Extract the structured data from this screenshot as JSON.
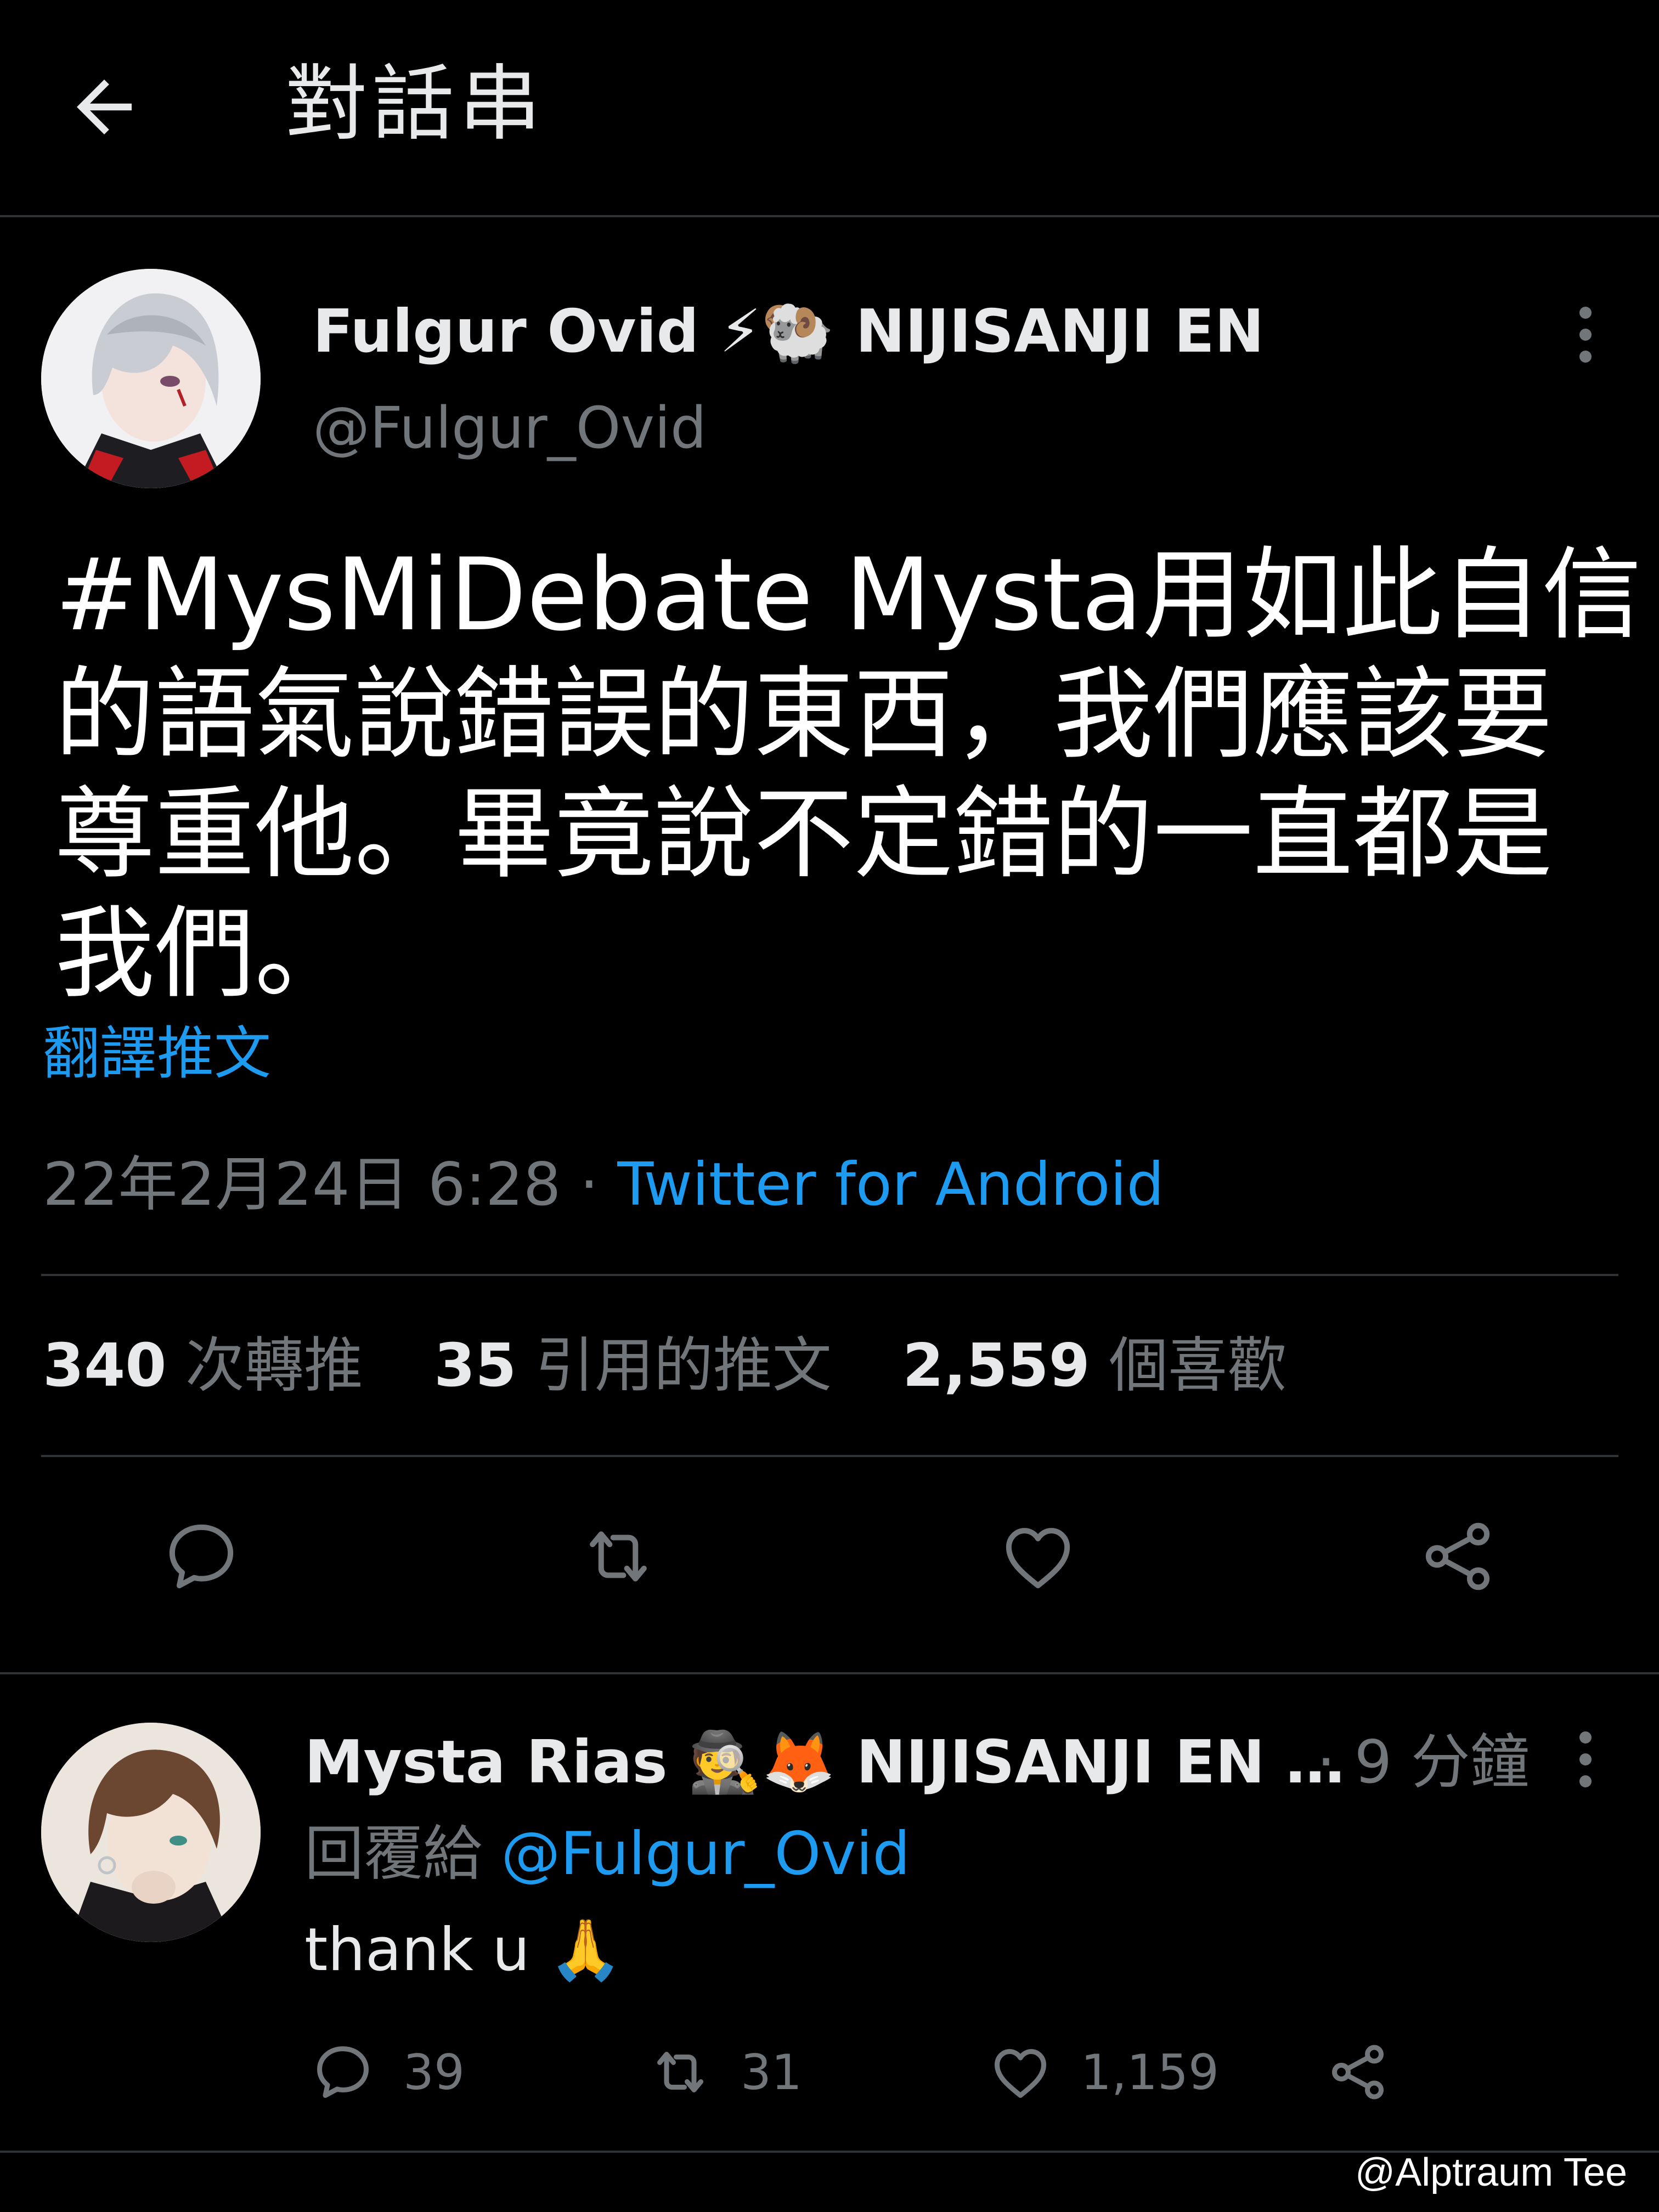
{
  "header": {
    "title": "對話串"
  },
  "main_tweet": {
    "display_name": "Fulgur Ovid ⚡🐏 NIJISANJI EN",
    "handle": "@Fulgur_Ovid",
    "text_lines": [
      "#MysMiDebate Mysta用如此自信",
      "的語氣說錯誤的東西，我們應該要",
      "尊重他。畢竟說不定錯的一直都是",
      "我們。"
    ],
    "translate_label": "翻譯推文",
    "timestamp": "22年2月24日 6:28",
    "separator": " · ",
    "source": "Twitter for Android",
    "stats": {
      "retweets_count": "340",
      "retweets_label": "次轉推",
      "quotes_count": "35",
      "quotes_label": "引用的推文",
      "likes_count": "2,559",
      "likes_label": "個喜歡"
    }
  },
  "reply": {
    "display_name": "Mysta Rias 🕵️🦊 NIJISANJI EN …",
    "time": "· 9 分鐘",
    "reply_prefix": "回覆給",
    "reply_to": "@Fulgur_Ovid",
    "text": "thank u 🙏",
    "reply_count": "39",
    "retweet_count": "31",
    "like_count": "1,159"
  },
  "watermark": "@Alptraum Tee",
  "colors": {
    "background": "#000000",
    "text_primary": "#e7e9ea",
    "text_secondary": "#71767b",
    "accent": "#1d9bf0",
    "divider": "#2f3336"
  },
  "icons": {
    "back": "arrow-left-icon",
    "more": "more-vertical-icon",
    "reply": "reply-icon",
    "retweet": "retweet-icon",
    "like": "heart-icon",
    "share": "share-icon"
  }
}
